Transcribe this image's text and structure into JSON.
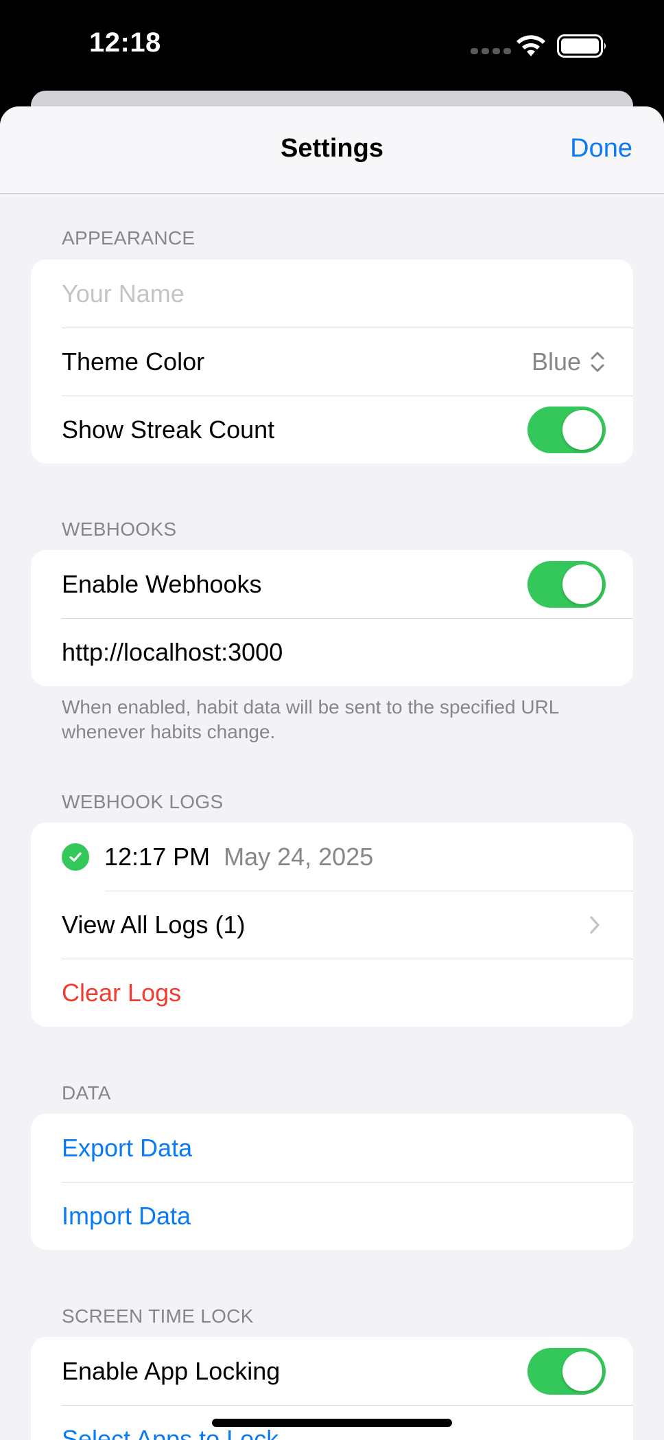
{
  "status": {
    "time": "12:18"
  },
  "nav": {
    "title": "Settings",
    "done": "Done"
  },
  "appearance": {
    "header": "APPEARANCE",
    "name_placeholder": "Your Name",
    "theme_label": "Theme Color",
    "theme_value": "Blue",
    "streak_label": "Show Streak Count",
    "streak_on": true
  },
  "webhooks": {
    "header": "WEBHOOKS",
    "enable_label": "Enable Webhooks",
    "enable_on": true,
    "url": "http://localhost:3000",
    "note": "When enabled, habit data will be sent to the specified URL whenever habits change."
  },
  "webhook_logs": {
    "header": "WEBHOOK LOGS",
    "entries": [
      {
        "time": "12:17 PM",
        "date": "May 24, 2025",
        "status": "success"
      }
    ],
    "view_all": "View All Logs (1)",
    "clear": "Clear Logs"
  },
  "data_section": {
    "header": "DATA",
    "export": "Export Data",
    "import": "Import Data"
  },
  "screen_time": {
    "header": "SCREEN TIME LOCK",
    "enable_label": "Enable App Locking",
    "enable_on": true,
    "select_apps": "Select Apps to Lock"
  },
  "colors": {
    "accent": "#0a7bf5",
    "toggle_on": "#34c759",
    "destructive": "#f23b30"
  }
}
